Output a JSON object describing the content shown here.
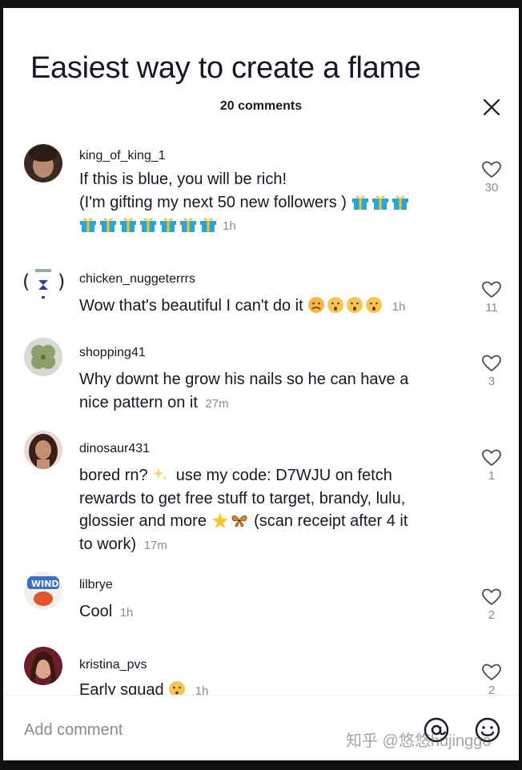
{
  "video": {
    "title": "Easiest way to create a flame"
  },
  "comments_header": {
    "count_label": "20 comments"
  },
  "comments": [
    {
      "username": "king_of_king_1",
      "line1": "If this is blue, you will be rich!",
      "line2": "(I'm gifting my next 50 new followers )",
      "time": "1h",
      "likes": "30"
    },
    {
      "username": "chicken_nuggeterrrs",
      "text": "Wow that's beautiful I can't do it",
      "time": "1h",
      "likes": "11"
    },
    {
      "username": "shopping41",
      "line1": "Why downt he grow his nails so he can have a",
      "line2": "nice pattern on it",
      "time": "27m",
      "likes": "3"
    },
    {
      "username": "dinosaur431",
      "line1": "bored rn?",
      "line1b": "use my code: D7WJU on fetch",
      "line2": "rewards to get free stuff to target, brandy, lulu,",
      "line3a": "glossier and more",
      "line3b": "(scan receipt after 4 it",
      "line4": "to work)",
      "time": "17m",
      "likes": "1"
    },
    {
      "username": "lilbrye",
      "text": "Cool",
      "time": "1h",
      "likes": "2"
    },
    {
      "username": "kristina_pvs",
      "text": "Early squad",
      "time": "1h",
      "likes": "2"
    }
  ],
  "footer": {
    "placeholder": "Add comment",
    "watermark": "知乎 @悠悠hujinggo"
  },
  "colors": {
    "text_primary": "#161823",
    "text_secondary": "#8a8b91",
    "gift_blue": "#2aa6d6",
    "gift_yellow": "#f2c230"
  },
  "icons": [
    "close-icon",
    "heart-icon",
    "gift-emoji",
    "sad-face-emoji",
    "sparkles-emoji",
    "star-emoji",
    "butterfly-emoji",
    "kiss-face-emoji",
    "at-mention-icon",
    "emoji-picker-icon"
  ]
}
